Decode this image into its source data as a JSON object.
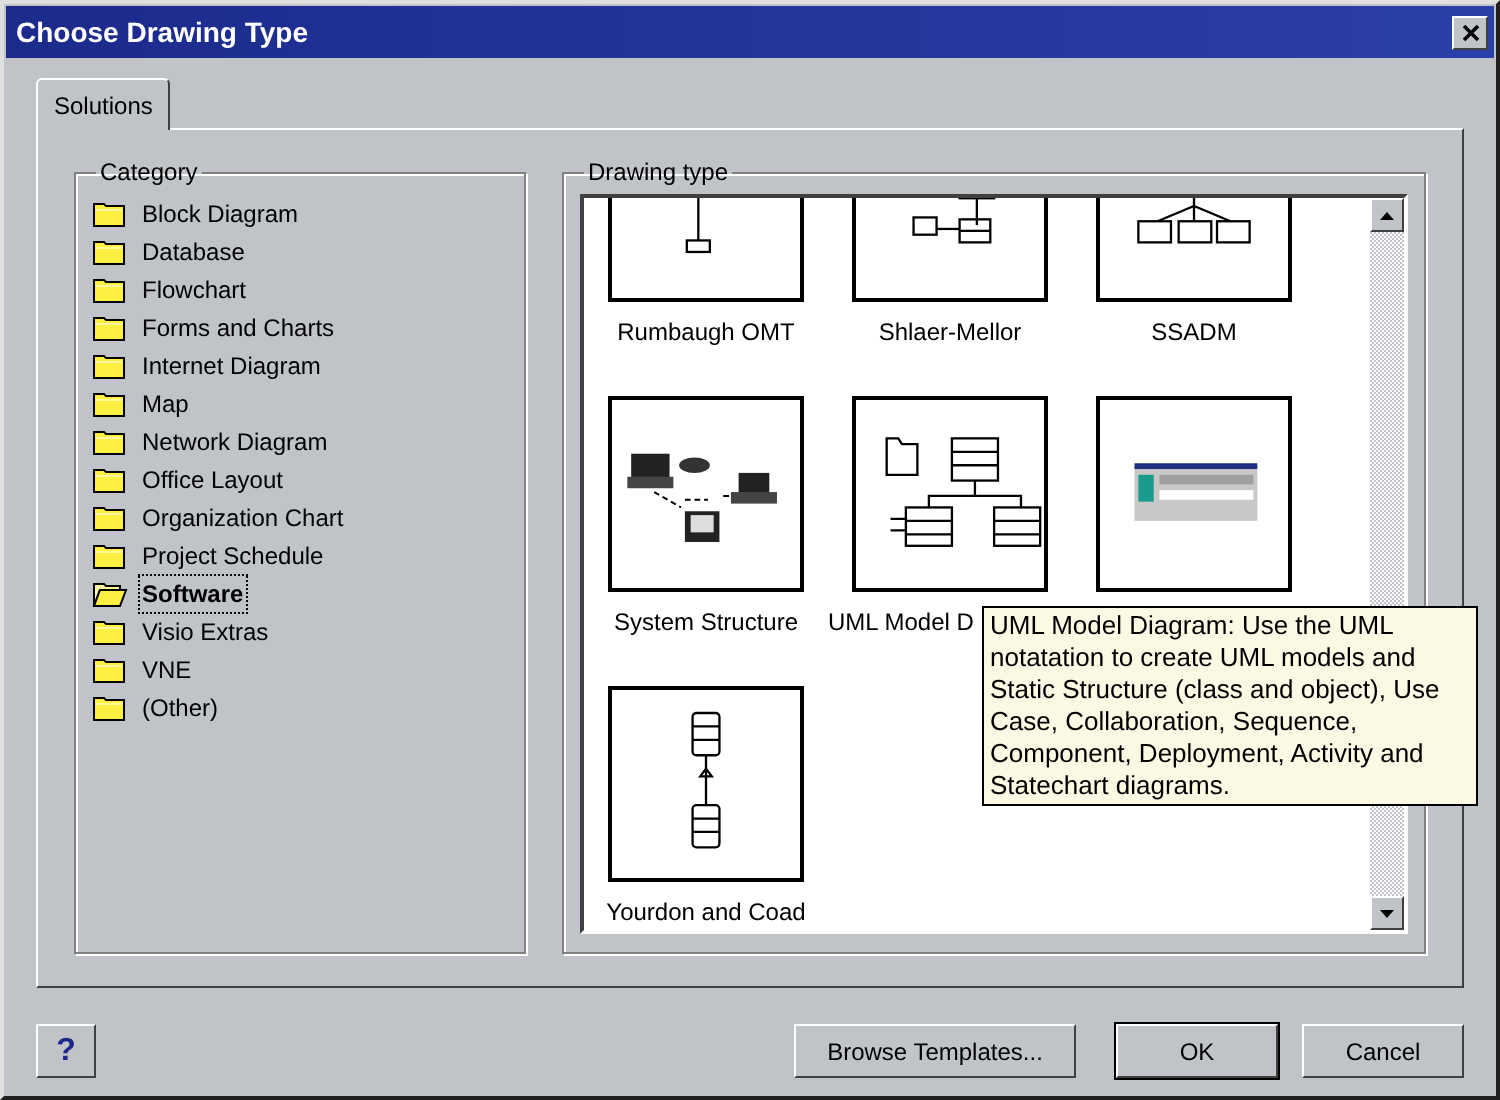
{
  "window": {
    "title": "Choose Drawing Type"
  },
  "tabs": [
    {
      "label": "Solutions",
      "selected": true
    }
  ],
  "category": {
    "label": "Category",
    "items": [
      {
        "label": "Block Diagram",
        "selected": false
      },
      {
        "label": "Database",
        "selected": false
      },
      {
        "label": "Flowchart",
        "selected": false
      },
      {
        "label": "Forms and Charts",
        "selected": false
      },
      {
        "label": "Internet Diagram",
        "selected": false
      },
      {
        "label": "Map",
        "selected": false
      },
      {
        "label": "Network Diagram",
        "selected": false
      },
      {
        "label": "Office Layout",
        "selected": false
      },
      {
        "label": "Organization Chart",
        "selected": false
      },
      {
        "label": "Project Schedule",
        "selected": false
      },
      {
        "label": "Software",
        "selected": true
      },
      {
        "label": "Visio Extras",
        "selected": false
      },
      {
        "label": "VNE",
        "selected": false
      },
      {
        "label": "(Other)",
        "selected": false
      }
    ]
  },
  "drawing_type": {
    "label": "Drawing type",
    "items": [
      {
        "label": "Rumbaugh OMT",
        "kind": "omt"
      },
      {
        "label": "Shlaer-Mellor",
        "kind": "shlaer"
      },
      {
        "label": "SSADM",
        "kind": "hierarchy"
      },
      {
        "label": "System Structure",
        "kind": "network"
      },
      {
        "label": "UML Model D",
        "kind": "uml",
        "tooltip": "UML Model Diagram:  Use the UML notatation to create UML models and Static Structure (class and object), Use Case, Collaboration, Sequence, Component, Deployment, Activity and Statechart diagrams."
      },
      {
        "kind": "window"
      },
      {
        "label": "Yourdon and Coad",
        "kind": "linked"
      }
    ]
  },
  "help_button": "?",
  "buttons": [
    {
      "label": "Browse Templates...",
      "default": false
    },
    {
      "label": "OK",
      "default": true
    },
    {
      "label": "Cancel",
      "default": false
    }
  ]
}
